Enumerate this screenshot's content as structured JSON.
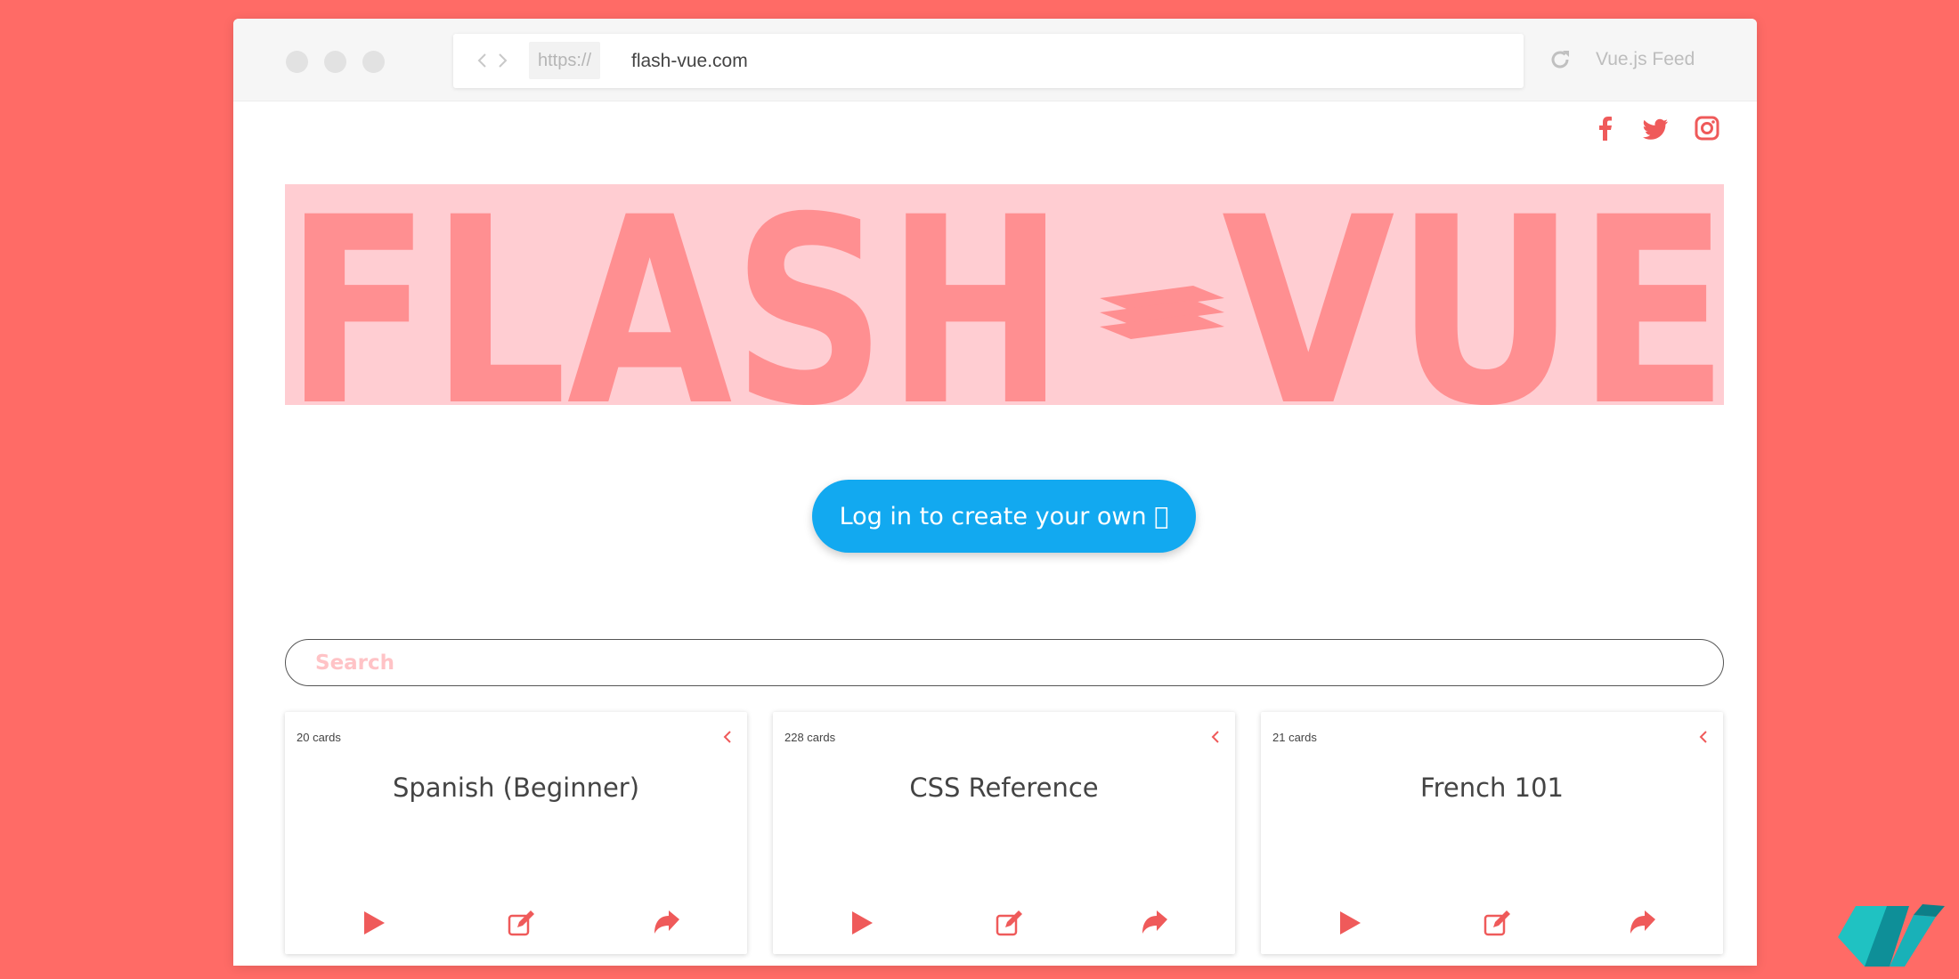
{
  "browser": {
    "protocol": "https://",
    "url": "flash-vue.com",
    "feed_label": "Vue.js Feed"
  },
  "social": [
    "facebook-icon",
    "twitter-icon",
    "instagram-icon"
  ],
  "logo": {
    "text_left": "FLASH",
    "text_right": "VUE"
  },
  "login": {
    "label": "Log in to create your own "
  },
  "search": {
    "placeholder": "Search",
    "value": ""
  },
  "decks": [
    {
      "count": "20 cards",
      "title": "Spanish (Beginner)"
    },
    {
      "count": "228 cards",
      "title": "CSS Reference"
    },
    {
      "count": "21 cards",
      "title": "French 101"
    }
  ],
  "colors": {
    "background": "#ff6b66",
    "accent": "#ef5a5a",
    "logo_band": "#ffcdd2",
    "logo_letters": "#ff8f91",
    "button": "#12a9f0"
  }
}
